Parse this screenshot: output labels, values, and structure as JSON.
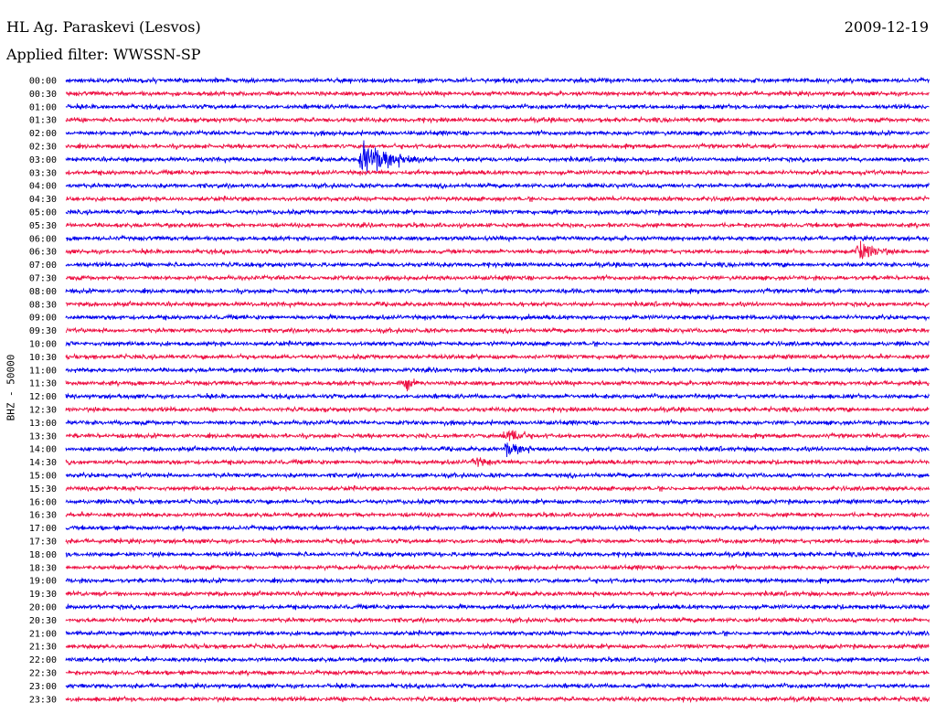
{
  "header": {
    "station": "HL Ag. Paraskevi (Lesvos)",
    "date": "2009-12-19",
    "filter": "Applied filter: WWSSN-SP"
  },
  "chart_data": {
    "type": "helicorder",
    "title": "HL Ag. Paraskevi (Lesvos)",
    "date": "2009-12-19",
    "filter": "WWSSN-SP",
    "ylabel": "BHZ - 50000",
    "row_labels": [
      "00:00",
      "00:30",
      "01:00",
      "01:30",
      "02:00",
      "02:30",
      "03:00",
      "03:30",
      "04:00",
      "04:30",
      "05:00",
      "05:30",
      "06:00",
      "06:30",
      "07:00",
      "07:30",
      "08:00",
      "08:30",
      "09:00",
      "09:30",
      "10:00",
      "10:30",
      "11:00",
      "11:30",
      "12:00",
      "12:30",
      "13:00",
      "13:30",
      "14:00",
      "14:30",
      "15:00",
      "15:30",
      "16:00",
      "16:30",
      "17:00",
      "17:30",
      "18:00",
      "18:30",
      "19:00",
      "19:30",
      "20:00",
      "20:30",
      "21:00",
      "21:30",
      "22:00",
      "22:30",
      "23:00",
      "23:30"
    ],
    "colors": [
      "#0000ee",
      "#ee1144"
    ],
    "minutes_per_line": 30,
    "events": [
      {
        "row": 6,
        "minute": 10.3,
        "amplitude": 2.0,
        "duration_min": 3.5,
        "type": "earthquake"
      },
      {
        "row": 13,
        "minute": 27.5,
        "amplitude": 1.3,
        "duration_min": 2.5,
        "type": "earthquake"
      },
      {
        "row": 27,
        "minute": 15.3,
        "amplitude": 1.1,
        "duration_min": 2.0,
        "type": "earthquake"
      },
      {
        "row": 28,
        "minute": 15.3,
        "amplitude": 0.9,
        "duration_min": 2.5,
        "type": "earthquake"
      },
      {
        "row": 29,
        "minute": 14.2,
        "amplitude": 0.7,
        "duration_min": 2.0,
        "type": "earthquake"
      },
      {
        "row": 23,
        "minute": 11.8,
        "amplitude": 0.9,
        "duration_min": 1.3,
        "type": "earthquake"
      }
    ]
  }
}
